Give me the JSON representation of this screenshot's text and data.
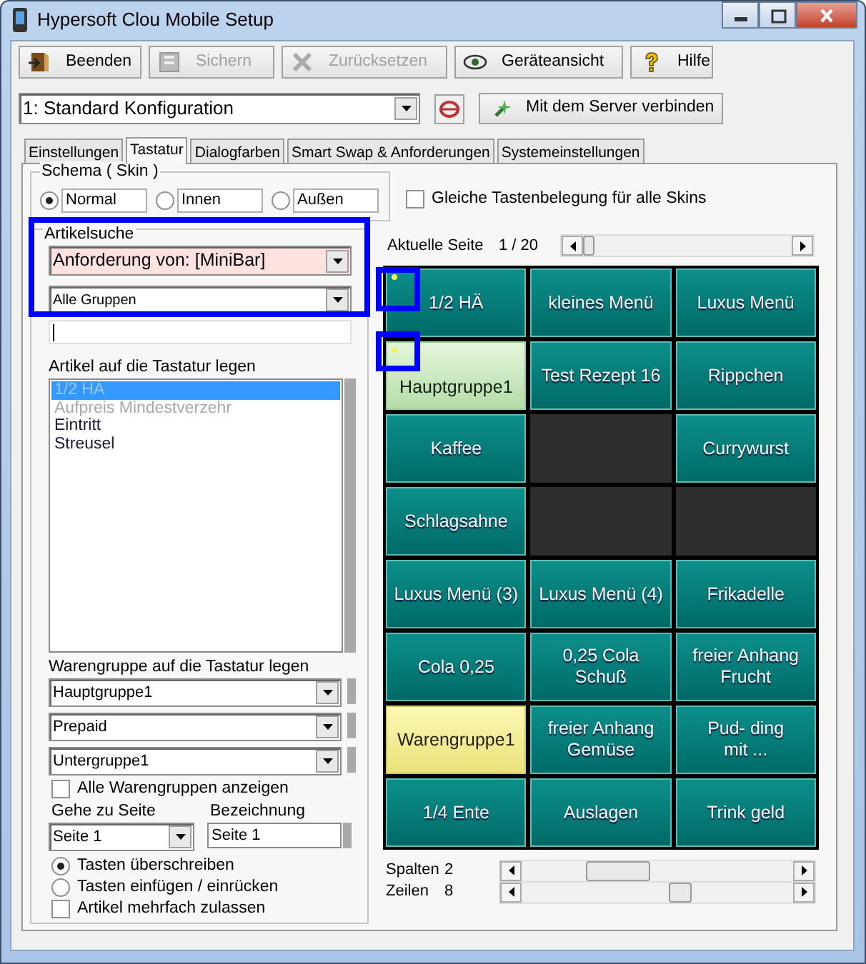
{
  "window": {
    "title": "Hypersoft Clou Mobile Setup"
  },
  "toolbar": [
    {
      "label": "Beenden",
      "disabled": false
    },
    {
      "label": "Sichern",
      "disabled": true
    },
    {
      "label": "Zurücksetzen",
      "disabled": true
    },
    {
      "label": "Geräteansicht",
      "disabled": false
    },
    {
      "label": "Hilfe",
      "disabled": false
    }
  ],
  "configuration": {
    "value": "1: Standard Konfiguration",
    "connect_button": "Mit dem Server verbinden"
  },
  "tabs": [
    {
      "label": "Einstellungen",
      "selected": false
    },
    {
      "label": "Tastatur",
      "selected": true
    },
    {
      "label": "Dialogfarben",
      "selected": false
    },
    {
      "label": "Smart Swap & Anforderungen",
      "selected": false
    },
    {
      "label": "Systemeinstellungen",
      "selected": false
    }
  ],
  "schema": {
    "title": "Schema ( Skin )",
    "options": [
      {
        "label": "Normal",
        "selected": true
      },
      {
        "label": "Innen",
        "selected": false
      },
      {
        "label": "Außen",
        "selected": false
      }
    ]
  },
  "same_layout": {
    "label": "Gleiche Tastenbelegung für alle Skins",
    "checked": false
  },
  "article_search": {
    "title": "Artikelsuche",
    "request": "Anforderung von: [MiniBar]",
    "group": "Alle Gruppen"
  },
  "articles": {
    "label": "Artikel auf die Tastatur legen",
    "items": [
      {
        "text": "1/2 HÄ",
        "selected": true,
        "disabled": true
      },
      {
        "text": "Aufpreis Mindestverzehr",
        "selected": false,
        "disabled": true
      },
      {
        "text": "Eintritt",
        "selected": false,
        "disabled": false
      },
      {
        "text": "Streusel",
        "selected": false,
        "disabled": false
      }
    ]
  },
  "product_groups": {
    "label": "Warengruppe auf die Tastatur legen",
    "dropdowns": [
      "Hauptgruppe1",
      "Prepaid",
      "Untergruppe1"
    ]
  },
  "show_all_groups": {
    "label": "Alle Warengruppen anzeigen",
    "checked": false
  },
  "go_to_page": {
    "label": "Gehe zu Seite",
    "value": "Seite 1"
  },
  "designation": {
    "label": "Bezeichnung",
    "value": "Seite 1"
  },
  "insert_mode": [
    {
      "label": "Tasten überschreiben",
      "selected": true
    },
    {
      "label": "Tasten einfügen / einrücken",
      "selected": false
    }
  ],
  "allow_multiple": {
    "label": "Artikel mehrfach zulassen",
    "checked": false
  },
  "current_page": {
    "label": "Aktuelle Seite",
    "value": "1 / 20"
  },
  "keys": [
    {
      "label": "1/2 HÄ",
      "kind": "item",
      "marked": true
    },
    {
      "label": "kleines Menü",
      "kind": "item",
      "marked": false
    },
    {
      "label": "Luxus Menü",
      "kind": "item",
      "marked": false
    },
    {
      "label": "Hauptgruppe1",
      "kind": "main_group",
      "marked": true
    },
    {
      "label": "Test Rezept 16",
      "kind": "item",
      "marked": false
    },
    {
      "label": "Rippchen",
      "kind": "item",
      "marked": false
    },
    {
      "label": "Kaffee",
      "kind": "item",
      "marked": false
    },
    {
      "kind": "empty"
    },
    {
      "label": "Currywurst",
      "kind": "item",
      "marked": false
    },
    {
      "label": "Schlagsahne",
      "kind": "item",
      "marked": false
    },
    {
      "kind": "empty"
    },
    {
      "kind": "empty"
    },
    {
      "label": "Luxus Menü (3)",
      "kind": "item",
      "marked": false
    },
    {
      "label": "Luxus Menü (4)",
      "kind": "item",
      "marked": false
    },
    {
      "label": "Frikadelle",
      "kind": "item",
      "marked": false
    },
    {
      "label": "Cola 0,25",
      "kind": "item",
      "marked": false
    },
    {
      "label": "0,25 Cola\nSchuß",
      "kind": "item",
      "marked": false
    },
    {
      "label": "freier Anhang\nFrucht",
      "kind": "item",
      "marked": false
    },
    {
      "label": "Warengruppe1",
      "kind": "product_group",
      "marked": false
    },
    {
      "label": "freier Anhang\nGemüse",
      "kind": "item",
      "marked": false
    },
    {
      "label": "Pud- ding\nmit ...",
      "kind": "item",
      "marked": false
    },
    {
      "label": "1/4 Ente",
      "kind": "item",
      "marked": false
    },
    {
      "label": "Auslagen",
      "kind": "item",
      "marked": false
    },
    {
      "label": "Trink geld",
      "kind": "item",
      "marked": false
    }
  ],
  "columns": {
    "label": "Spalten",
    "value": "2"
  },
  "rows": {
    "label": "Zeilen",
    "value": "8"
  }
}
